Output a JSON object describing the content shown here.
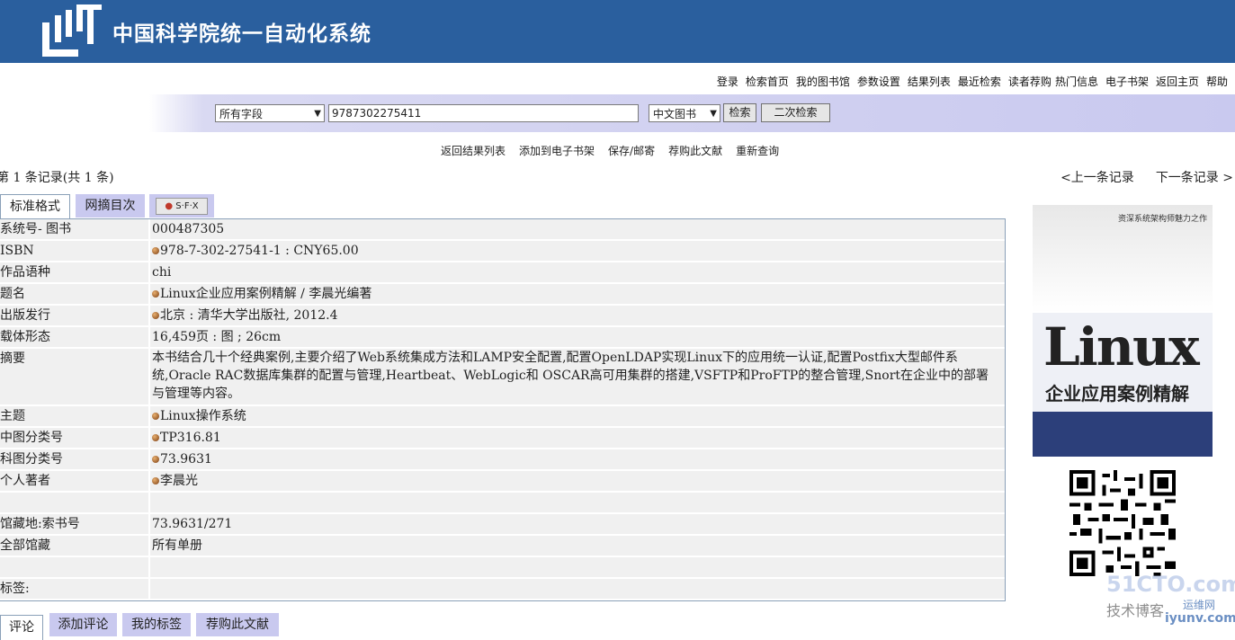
{
  "header": {
    "title": "中国科学院统一自动化系统"
  },
  "topnav": [
    "登录",
    "检索首页",
    "我的图书馆",
    "参数设置",
    "结果列表",
    "最近检索",
    "读者荐购",
    "热门信息",
    "电子书架",
    "返回主页",
    "帮助"
  ],
  "search": {
    "field_select": "所有字段",
    "query": "9787302275411",
    "db_select": "中文图书",
    "search_button": "检索",
    "secondary_button": "二次检索"
  },
  "actions": [
    "返回结果列表",
    "添加到电子书架",
    "保存/邮寄",
    "荐购此文献",
    "重新查询"
  ],
  "record": {
    "info": "第 1 条记录(共 1 条)",
    "prev": "<上一条记录",
    "next": "下一条记录 >"
  },
  "tabs": [
    "标准格式",
    "网摘目次",
    "S·F·X"
  ],
  "details": [
    {
      "label": "系统号- 图书",
      "value": "000487305",
      "bullet": false
    },
    {
      "label": "ISBN",
      "value": "978-7-302-27541-1 : CNY65.00",
      "bullet": true
    },
    {
      "label": "作品语种",
      "value": "chi",
      "bullet": false
    },
    {
      "label": "题名",
      "value": "Linux企业应用案例精解 / 李晨光编著",
      "bullet": true
    },
    {
      "label": "出版发行",
      "value": "北京 : 清华大学出版社, 2012.4",
      "bullet": true
    },
    {
      "label": "载体形态",
      "value": "16,459页 : 图 ; 26cm",
      "bullet": false
    },
    {
      "label": "摘要",
      "value": "本书结合几十个经典案例,主要介绍了Web系统集成方法和LAMP安全配置,配置OpenLDAP实现Linux下的应用统一认证,配置Postfix大型邮件系统,Oracle RAC数据库集群的配置与管理,Heartbeat、WebLogic和 OSCAR高可用集群的搭建,VSFTP和ProFTP的整合管理,Snort在企业中的部署与管理等内容。",
      "bullet": false
    },
    {
      "label": "主题",
      "value": "Linux操作系统",
      "bullet": true
    },
    {
      "label": "中图分类号",
      "value": "TP316.81",
      "bullet": true
    },
    {
      "label": "科图分类号",
      "value": "73.9631",
      "bullet": true
    },
    {
      "label": "个人著者",
      "value": "李晨光",
      "bullet": true
    },
    {
      "label": "",
      "value": "",
      "bullet": false
    },
    {
      "label": "馆藏地:索书号",
      "value": "73.9631/271",
      "bullet": false
    },
    {
      "label": "全部馆藏",
      "value": "所有单册",
      "bullet": false
    },
    {
      "label": "",
      "value": "",
      "bullet": false
    },
    {
      "label": "标签:",
      "value": "",
      "bullet": false
    }
  ],
  "cover": {
    "title": "Linux",
    "subtitle": "企业应用案例精解",
    "series": "资深系统架构师魅力之作"
  },
  "watermark": {
    "line1": "51CTO.com",
    "line2": "技术博客",
    "line3": "运维网",
    "line4": "iyunv.com"
  },
  "bottom_tabs": [
    "评论",
    "添加评论",
    "我的标签",
    "荐购此文献"
  ]
}
